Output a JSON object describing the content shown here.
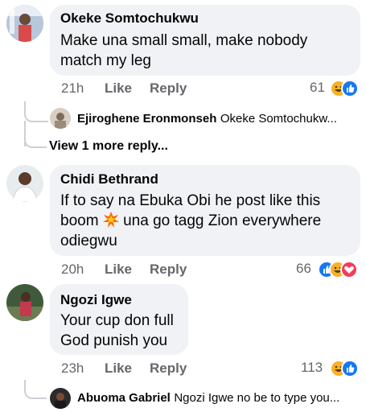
{
  "comments": [
    {
      "name": "Okeke Somtochukwu",
      "text_lines": [
        "Make una small small, make nobody",
        "match my leg"
      ],
      "time": "21h",
      "like": "Like",
      "reply": "Reply",
      "count": "61",
      "reactions": [
        "haha",
        "like"
      ]
    },
    {
      "name": "Chidi Bethrand",
      "text_lines": [
        "If to say na Ebuka Obi he post like this",
        "boom",
        "una go tagg Zion everywhere",
        "odiegwu"
      ],
      "time": "20h",
      "like": "Like",
      "reply": "Reply",
      "count": "66",
      "reactions": [
        "like",
        "haha",
        "love"
      ]
    },
    {
      "name": "Ngozi Igwe",
      "text_lines": [
        "Your cup don full",
        "God punish you"
      ],
      "time": "23h",
      "like": "Like",
      "reply": "Reply",
      "count": "113",
      "reactions": [
        "haha",
        "like"
      ]
    }
  ],
  "replies": [
    {
      "name": "Ejiroghene Eronmonseh",
      "preview": "Okeke Somtochukw..."
    },
    {
      "name": "Abuoma Gabriel",
      "preview": "Ngozi Igwe no be to type you..."
    }
  ],
  "view_more": "View 1 more reply...",
  "colors": {
    "like": "#1877f2",
    "haha": "#f7b125",
    "love": "#f33e58",
    "bubble": "#f0f2f5",
    "meta": "#65676b"
  }
}
